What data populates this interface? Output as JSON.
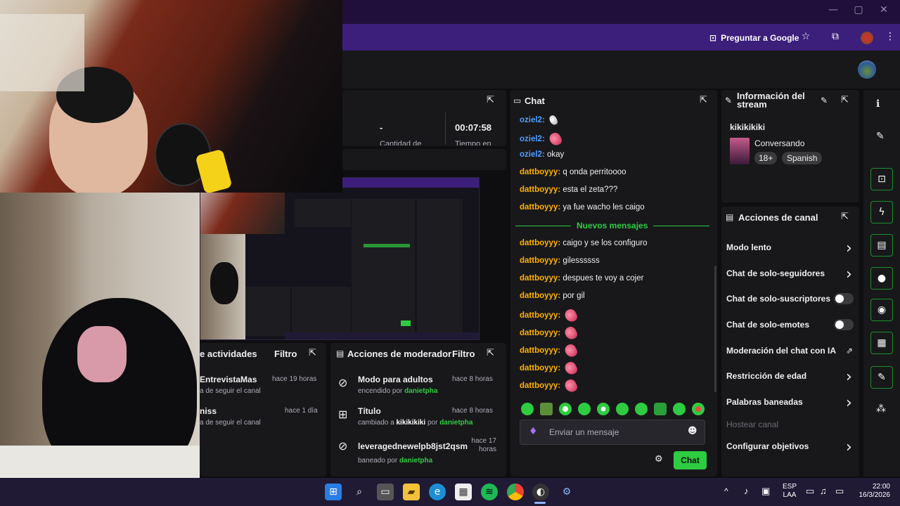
{
  "browser": {
    "ask_google_label": "Preguntar a Google"
  },
  "stats": {
    "dash": "-",
    "time": "00:07:58",
    "label1": "Cantidad de",
    "label2": "Tiempo en"
  },
  "chat": {
    "title": "Chat",
    "messages_before": [
      {
        "user": "oziel2:",
        "text": "",
        "emote": "white",
        "color": "a"
      },
      {
        "user": "oziel2:",
        "text": "",
        "emote": "pink",
        "color": "a"
      },
      {
        "user": "oziel2:",
        "text": "okay",
        "emote": "",
        "color": "a"
      },
      {
        "user": "dattboyyy:",
        "text": "q onda perritoooo",
        "emote": "",
        "color": "b"
      },
      {
        "user": "dattboyyy:",
        "text": "esta el zeta???",
        "emote": "",
        "color": "b"
      },
      {
        "user": "dattboyyy:",
        "text": "ya fue wacho les caigo",
        "emote": "",
        "color": "b"
      }
    ],
    "new_messages_label": "Nuevos mensajes",
    "messages_after": [
      {
        "user": "dattboyyy:",
        "text": "caigo y se los configuro",
        "emote": ""
      },
      {
        "user": "dattboyyy:",
        "text": "gilessssss",
        "emote": ""
      },
      {
        "user": "dattboyyy:",
        "text": "despues te voy a cojer",
        "emote": ""
      },
      {
        "user": "dattboyyy:",
        "text": "por gil",
        "emote": ""
      },
      {
        "user": "dattboyyy:",
        "text": "",
        "emote": "pink"
      },
      {
        "user": "dattboyyy:",
        "text": "",
        "emote": "pink"
      },
      {
        "user": "dattboyyy:",
        "text": "",
        "emote": "pink"
      },
      {
        "user": "dattboyyy:",
        "text": "",
        "emote": "pink"
      },
      {
        "user": "dattboyyy:",
        "text": "",
        "emote": "pink"
      }
    ],
    "input_placeholder": "Enviar un mensaje",
    "send_label": "Chat"
  },
  "stream_info": {
    "title": "Información del stream",
    "stream_title": "kikikikiki",
    "category": "Conversando",
    "tags": [
      "18+",
      "Spanish"
    ]
  },
  "channel_actions": {
    "title": "Acciones de canal",
    "items": [
      {
        "label": "Modo lento",
        "control": "arrow"
      },
      {
        "label": "Chat de solo-seguidores",
        "control": "arrow"
      },
      {
        "label": "Chat de solo-suscriptores",
        "control": "toggle"
      },
      {
        "label": "Chat de solo-emotes",
        "control": "toggle"
      },
      {
        "label": "Moderación del chat con IA",
        "control": "external"
      },
      {
        "label": "Restricción de edad",
        "control": "arrow"
      },
      {
        "label": "Palabras baneadas",
        "control": "arrow"
      },
      {
        "label": "Hostear canal",
        "control": "disabled"
      },
      {
        "label": "Configurar objetivos",
        "control": "arrow"
      }
    ]
  },
  "activities": {
    "title": "e actividades",
    "filter_label": "Filtro",
    "items": [
      {
        "name": "EntrevistaMas",
        "desc": "a de seguir el canal",
        "time": "hace 19 horas"
      },
      {
        "name": "niss",
        "desc": "a de seguir el canal",
        "time": "hace 1 día"
      }
    ]
  },
  "mod_actions": {
    "title": "Acciones de moderador",
    "filter_label": "Filtro",
    "items": [
      {
        "title": "Modo para adultos",
        "desc_pre": "encendido por",
        "desc_value": "",
        "desc_mid": "",
        "by": "danietpha",
        "time": "hace 8 horas"
      },
      {
        "title": "Título",
        "desc_pre": "cambiado a",
        "desc_value": "kikikikiki",
        "desc_mid": "por",
        "by": "danietpha",
        "time": "hace 8 horas"
      },
      {
        "title": "leveragednewelpb8jst2qsm",
        "desc_pre": "baneado por",
        "desc_value": "",
        "desc_mid": "",
        "by": "danietpha",
        "time": "hace 17 horas"
      }
    ]
  },
  "taskbar": {
    "lang1": "ESP",
    "lang2": "LAA",
    "time": "22:00",
    "date": "16/3/2026"
  },
  "colors": {
    "accent_green": "#2ecc40",
    "username_blue": "#4f9eff",
    "username_orange": "#ffb000",
    "browser_purple": "#3b1f7a"
  }
}
